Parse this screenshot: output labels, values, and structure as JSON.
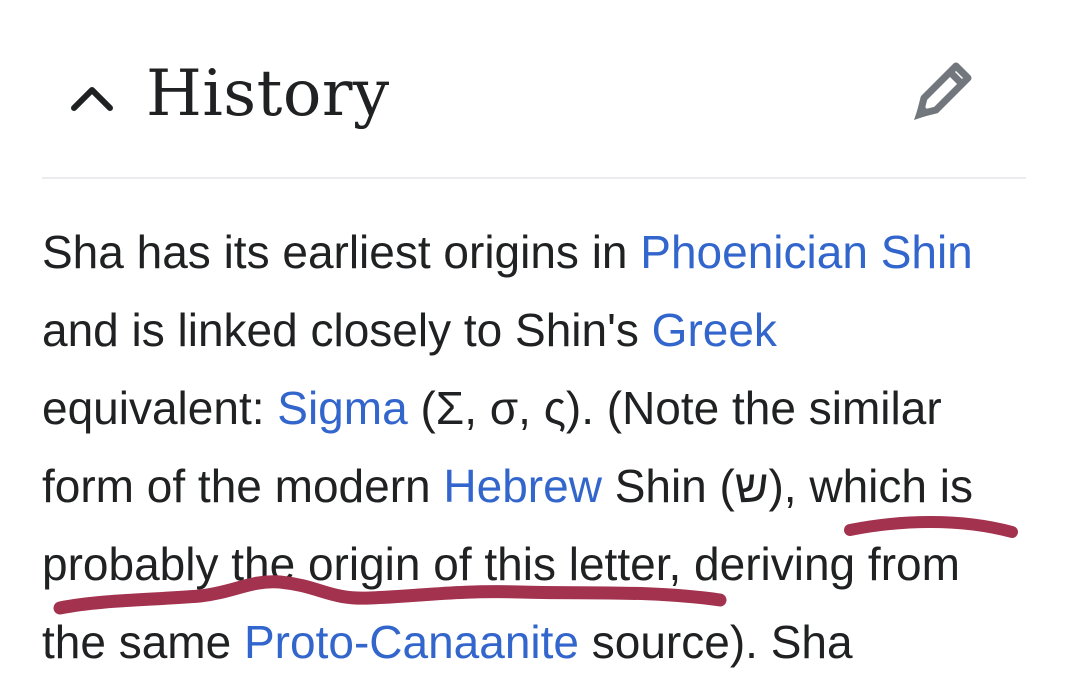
{
  "section": {
    "title": "History",
    "collapse_icon": "chevron-up-icon",
    "edit_icon": "pencil-icon"
  },
  "paragraph": {
    "l1_a": "Sha has its earliest origins in ",
    "l1_link": "Phoenician Shin",
    "l2_a": "and is linked closely to Shin's ",
    "l2_link": "Greek",
    "l3_a": "equivalent: ",
    "l3_link": "Sigma",
    "l3_b": " (Σ, σ, ς). (Note the similar",
    "l4_a": "form of the modern ",
    "l4_link": "Hebrew",
    "l4_b": " Shin (ש), which is",
    "l5_a": "probably the origin of this letter, deriving from",
    "l6_a": "the same ",
    "l6_link": "Proto-Canaanite",
    "l6_b": " source). Sha"
  },
  "colors": {
    "text": "#202122",
    "link": "#3366cc",
    "annotation": "#a3324e",
    "icon": "#72777d"
  }
}
